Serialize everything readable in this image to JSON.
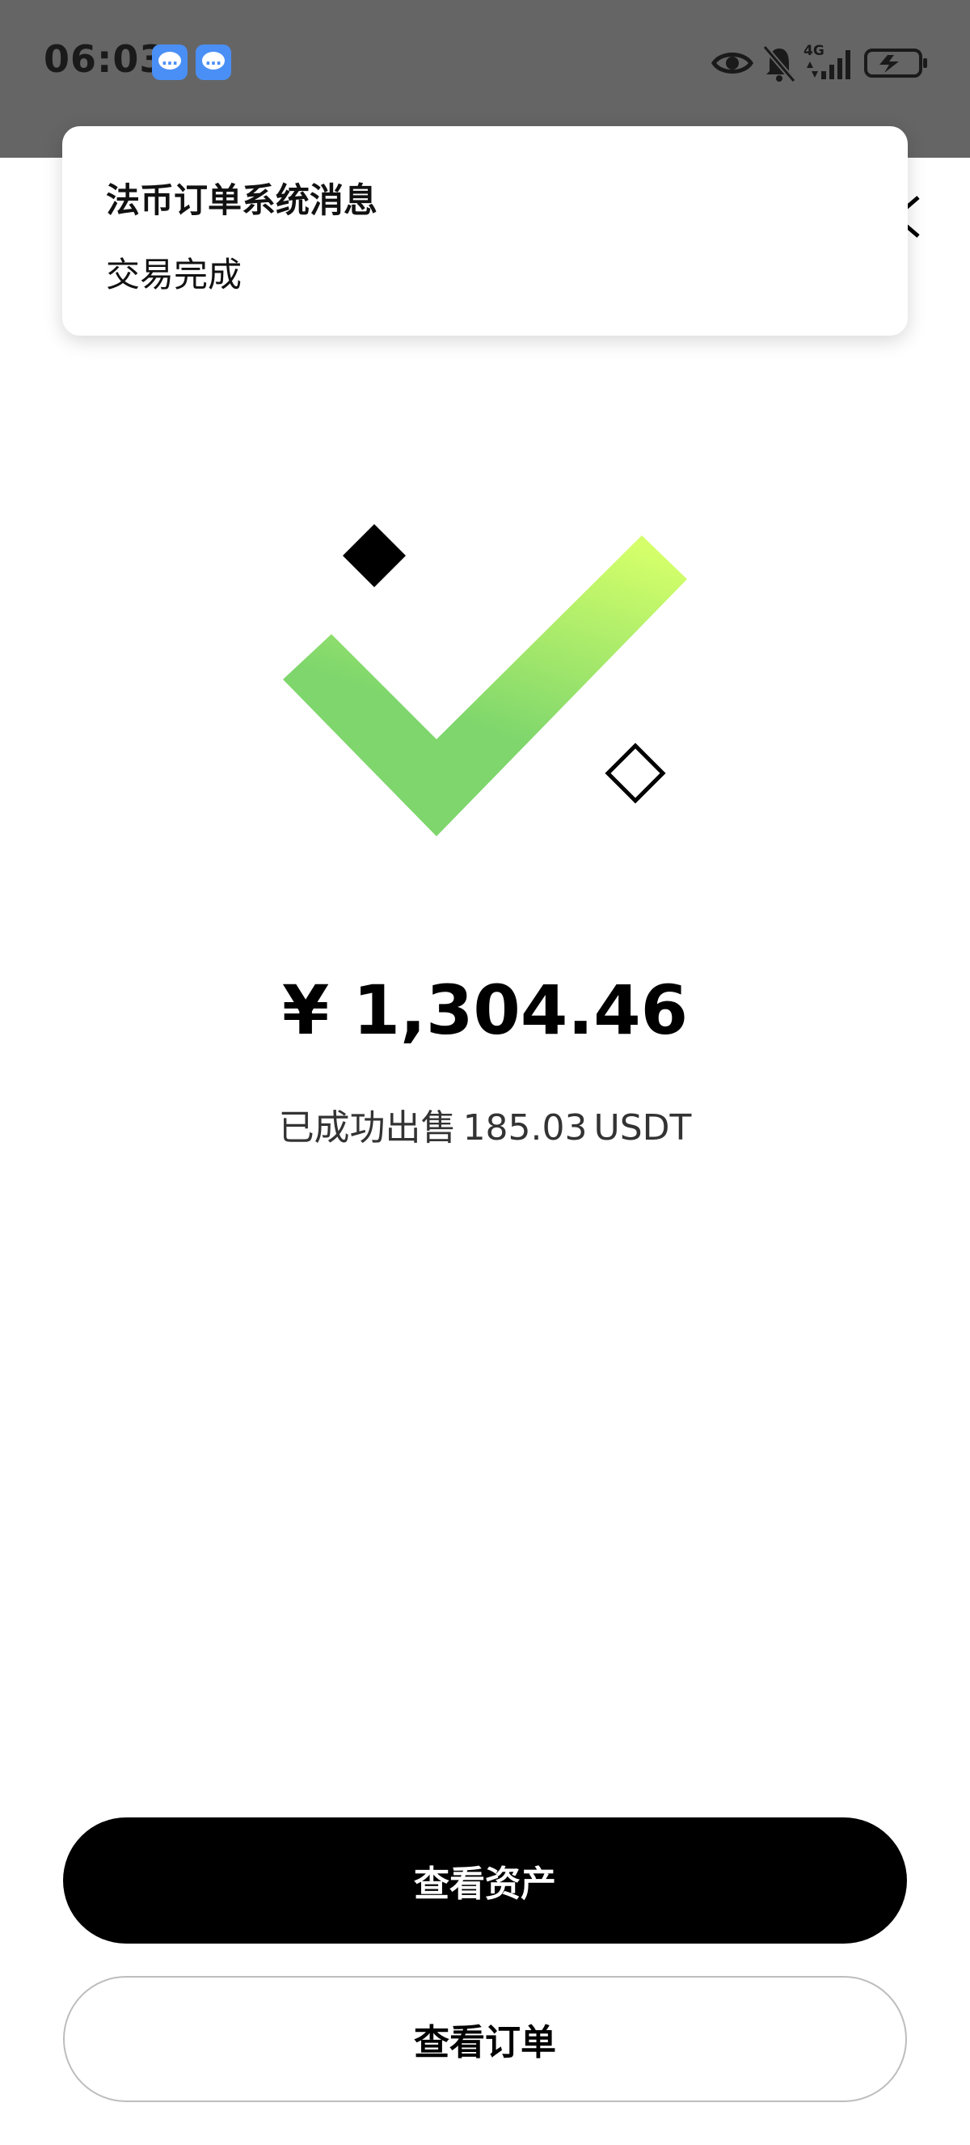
{
  "status_bar": {
    "time": "06:03",
    "network": "4G"
  },
  "notification": {
    "title": "法币订单系统消息",
    "body": "交易完成"
  },
  "result": {
    "amount": "¥ 1,304.46",
    "description": "已成功出售",
    "quantity": "185.03",
    "asset": "USDT"
  },
  "actions": {
    "view_assets_label": "查看资产",
    "view_orders_label": "查看订单"
  },
  "colors": {
    "status_bar_bg": "#656565",
    "check_top": "#d4ff6a",
    "check_bottom": "#7ed66c",
    "primary_button": "#000000"
  }
}
